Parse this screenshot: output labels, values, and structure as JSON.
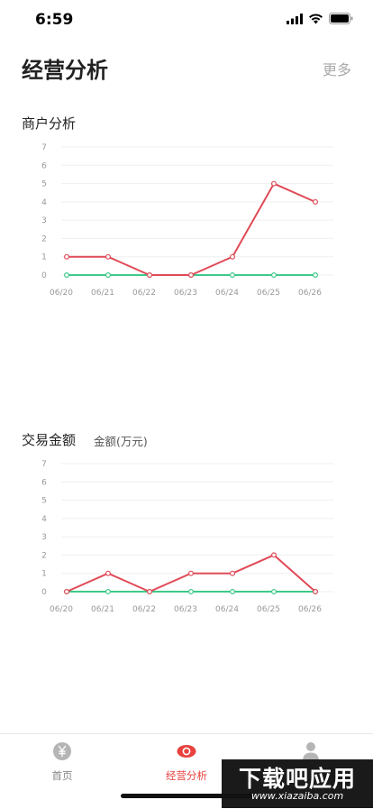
{
  "status_bar": {
    "time": "6:59",
    "icons": [
      "cellular-signal-icon",
      "wifi-icon",
      "battery-icon"
    ]
  },
  "header": {
    "title": "经营分析",
    "more": "更多"
  },
  "merchant_section": {
    "title": "商户分析"
  },
  "trade_section": {
    "title": "交易金额",
    "unit_label": "金额(万元)"
  },
  "charts": {
    "merchant": {
      "type": "line",
      "categories": [
        "06/20",
        "06/21",
        "06/22",
        "06/23",
        "06/24",
        "06/25",
        "06/26"
      ],
      "y_ticks": [
        "0",
        "1",
        "2",
        "3",
        "4",
        "5",
        "6",
        "7"
      ],
      "ylim": [
        0,
        7
      ],
      "grid": true,
      "series": [
        {
          "color": "#e04a57",
          "values": [
            1,
            1,
            0,
            0,
            1,
            5,
            4
          ]
        },
        {
          "color": "#3ec98a",
          "values": [
            0,
            0,
            0,
            0,
            0,
            0,
            0
          ]
        }
      ]
    },
    "trade": {
      "type": "line",
      "categories": [
        "06/20",
        "06/21",
        "06/22",
        "06/23",
        "06/24",
        "06/25",
        "06/26"
      ],
      "y_ticks": [
        "0",
        "1",
        "2",
        "3",
        "4",
        "5",
        "6",
        "7"
      ],
      "ylim": [
        0,
        7
      ],
      "grid": true,
      "series": [
        {
          "color": "#e04a57",
          "values": [
            0,
            1,
            0,
            1,
            1,
            2,
            0
          ]
        },
        {
          "color": "#3ec98a",
          "values": [
            0,
            0,
            0,
            0,
            0,
            0,
            0
          ]
        }
      ]
    }
  },
  "tab_bar": {
    "active_color": "#e8423f",
    "inactive_color": "#888888",
    "items": [
      {
        "label": "首页",
        "icon": "yen-coin-icon",
        "active": false
      },
      {
        "label": "经营分析",
        "icon": "eye-icon",
        "active": true
      },
      {
        "label": "",
        "icon": "person-icon",
        "active": false
      }
    ]
  },
  "watermark": {
    "main": "下载吧应用",
    "sub": "www.xiazaiba.com"
  }
}
